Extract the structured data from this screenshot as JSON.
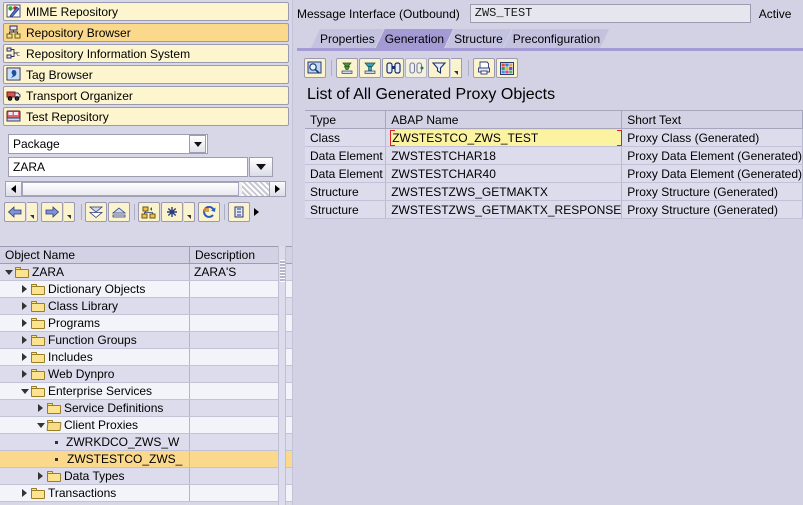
{
  "sidebar": {
    "nav_buttons": [
      {
        "label": "MIME Repository",
        "icon": "mime-repository-icon",
        "active": false
      },
      {
        "label": "Repository Browser",
        "icon": "repository-browser-icon",
        "active": true
      },
      {
        "label": "Repository Information System",
        "icon": "repository-info-system-icon",
        "active": false
      },
      {
        "label": "Tag Browser",
        "icon": "tag-browser-icon",
        "active": false
      },
      {
        "label": "Transport Organizer",
        "icon": "transport-organizer-icon",
        "active": false
      },
      {
        "label": "Test Repository",
        "icon": "test-repository-icon",
        "active": false
      }
    ],
    "object_type_select": {
      "value": "Package",
      "icon": "chevron-down-icon"
    },
    "object_name_input": {
      "value": "ZARA",
      "placeholder": ""
    },
    "toolbar": [
      {
        "name": "back-button",
        "icon": "arrow-left-icon"
      },
      {
        "name": "forward-button",
        "icon": "arrow-right-icon"
      },
      {
        "name": "collapse-node-button",
        "icon": "chevron-double-down-icon"
      },
      {
        "name": "expand-node-button",
        "icon": "chevron-double-up-icon"
      },
      {
        "name": "object-list-button",
        "icon": "hierarchy-icon"
      },
      {
        "name": "expand-all-button",
        "icon": "asterisk-icon"
      },
      {
        "name": "refresh-button",
        "icon": "refresh-icon"
      },
      {
        "name": "more-button",
        "icon": "more-icon"
      }
    ],
    "tree_headers": {
      "name": "Object Name",
      "description": "Description"
    },
    "tree": [
      {
        "label": "ZARA",
        "desc": "ZARA'S",
        "indent": 0,
        "state": "expanded",
        "type": "folder",
        "highlight": false
      },
      {
        "label": "Dictionary Objects",
        "desc": "",
        "indent": 1,
        "state": "collapsed",
        "type": "folder",
        "highlight": false
      },
      {
        "label": "Class Library",
        "desc": "",
        "indent": 1,
        "state": "collapsed",
        "type": "folder",
        "highlight": false
      },
      {
        "label": "Programs",
        "desc": "",
        "indent": 1,
        "state": "collapsed",
        "type": "folder",
        "highlight": false
      },
      {
        "label": "Function Groups",
        "desc": "",
        "indent": 1,
        "state": "collapsed",
        "type": "folder",
        "highlight": false
      },
      {
        "label": "Includes",
        "desc": "",
        "indent": 1,
        "state": "collapsed",
        "type": "folder",
        "highlight": false
      },
      {
        "label": "Web Dynpro",
        "desc": "",
        "indent": 1,
        "state": "collapsed",
        "type": "folder",
        "highlight": false
      },
      {
        "label": "Enterprise Services",
        "desc": "",
        "indent": 1,
        "state": "expanded",
        "type": "folder",
        "highlight": false
      },
      {
        "label": "Service Definitions",
        "desc": "",
        "indent": 2,
        "state": "collapsed",
        "type": "folder",
        "highlight": false
      },
      {
        "label": "Client Proxies",
        "desc": "",
        "indent": 2,
        "state": "expanded",
        "type": "folder-open",
        "highlight": false
      },
      {
        "label": "ZWRKDCO_ZWS_W",
        "desc": "",
        "indent": 3,
        "state": "leaf",
        "type": "leaf",
        "highlight": false
      },
      {
        "label": "ZWSTESTCO_ZWS_",
        "desc": "",
        "indent": 3,
        "state": "leaf",
        "type": "leaf",
        "highlight": true
      },
      {
        "label": "Data Types",
        "desc": "",
        "indent": 2,
        "state": "collapsed",
        "type": "folder",
        "highlight": false
      },
      {
        "label": "Transactions",
        "desc": "",
        "indent": 1,
        "state": "collapsed",
        "type": "folder",
        "highlight": false
      }
    ]
  },
  "editor": {
    "header": {
      "label": "Message Interface (Outbound)",
      "object_name": "ZWS_TEST",
      "status": "Active"
    },
    "tabs": [
      {
        "label": "Properties",
        "selected": false
      },
      {
        "label": "Generation",
        "selected": true
      },
      {
        "label": "Structure",
        "selected": false
      },
      {
        "label": "Preconfiguration",
        "selected": false
      }
    ],
    "toolbar": [
      {
        "name": "display-details-button",
        "icon": "magnifier-details-icon"
      },
      {
        "name": "sort-ascending-button",
        "icon": "sort-ascending-icon"
      },
      {
        "name": "sort-descending-button",
        "icon": "sort-descending-icon"
      },
      {
        "name": "find-button",
        "icon": "binoculars-icon"
      },
      {
        "name": "find-next-button",
        "icon": "binoculars-next-icon"
      },
      {
        "name": "filter-button",
        "icon": "filter-icon"
      },
      {
        "name": "print-button",
        "icon": "print-icon"
      },
      {
        "name": "layout-button",
        "icon": "layout-grid-icon"
      }
    ],
    "list": {
      "title": "List of All Generated Proxy Objects",
      "columns": [
        "Type",
        "ABAP Name",
        "Short Text"
      ],
      "rows": [
        {
          "type": "Class",
          "name": "ZWSTESTCO_ZWS_TEST",
          "short_text": "Proxy Class (Generated)",
          "focused": true
        },
        {
          "type": "Data Element",
          "name": "ZWSTESTCHAR18",
          "short_text": "Proxy Data Element (Generated)",
          "focused": false
        },
        {
          "type": "Data Element",
          "name": "ZWSTESTCHAR40",
          "short_text": "Proxy Data Element (Generated)",
          "focused": false
        },
        {
          "type": "Structure",
          "name": "ZWSTESTZWS_GETMAKTX",
          "short_text": "Proxy Structure (Generated)",
          "focused": false
        },
        {
          "type": "Structure",
          "name": "ZWSTESTZWS_GETMAKTX_RESPONSE",
          "short_text": "Proxy Structure (Generated)",
          "focused": false
        }
      ]
    }
  },
  "colors": {
    "window_bg": "#d2d2e4",
    "button_yellow": "#fbf3cd",
    "button_active": "#fbd98c",
    "tab_selected": "#a49bd4",
    "tab_normal": "#c3c3e0",
    "row_bg": "#dcdcec",
    "focus_red": "#e02020",
    "highlight_yellow": "#fbf3a0"
  }
}
